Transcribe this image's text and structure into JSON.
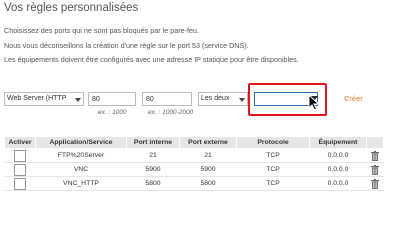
{
  "header": {
    "title": "Vos règles personnalisées",
    "lines": [
      "Choisissez des ports qui ne sont pas bloqués par le pare-feu.",
      "Nous vous déconseillons la création d'une règle sur le port 53 (service DNS).",
      "Les équipements doivent être configurés avec une adresse IP statique pour être disponibles."
    ]
  },
  "form": {
    "application_select": "Web Server (HTTP",
    "internal_port_value": "80",
    "internal_port_hint": "ex. : 1000",
    "external_port_value": "80",
    "external_port_hint": "ex. : 1000-2000",
    "protocol_select": "Les deux",
    "device_select": "",
    "create_label": "Créer"
  },
  "table": {
    "headers": [
      "Activer",
      "Application/Service",
      "Port interne",
      "Port externe",
      "Protocole",
      "Équipement",
      ""
    ],
    "rows": [
      {
        "service": "FTP%20Server",
        "internal": "21",
        "external": "21",
        "protocol": "TCP",
        "device": "0.0.0.0"
      },
      {
        "service": "VNC",
        "internal": "5900",
        "external": "5900",
        "protocol": "TCP",
        "device": "0.0.0.0"
      },
      {
        "service": "VNC_HTTP",
        "internal": "5800",
        "external": "5800",
        "protocol": "TCP",
        "device": "0.0.0.0"
      }
    ]
  },
  "icons": {
    "trash": "trash-icon",
    "cursor": "mouse-pointer-icon"
  },
  "colors": {
    "highlight": "#e0181e",
    "create_link": "#e0781e",
    "focus_border": "#2f6fb7"
  }
}
